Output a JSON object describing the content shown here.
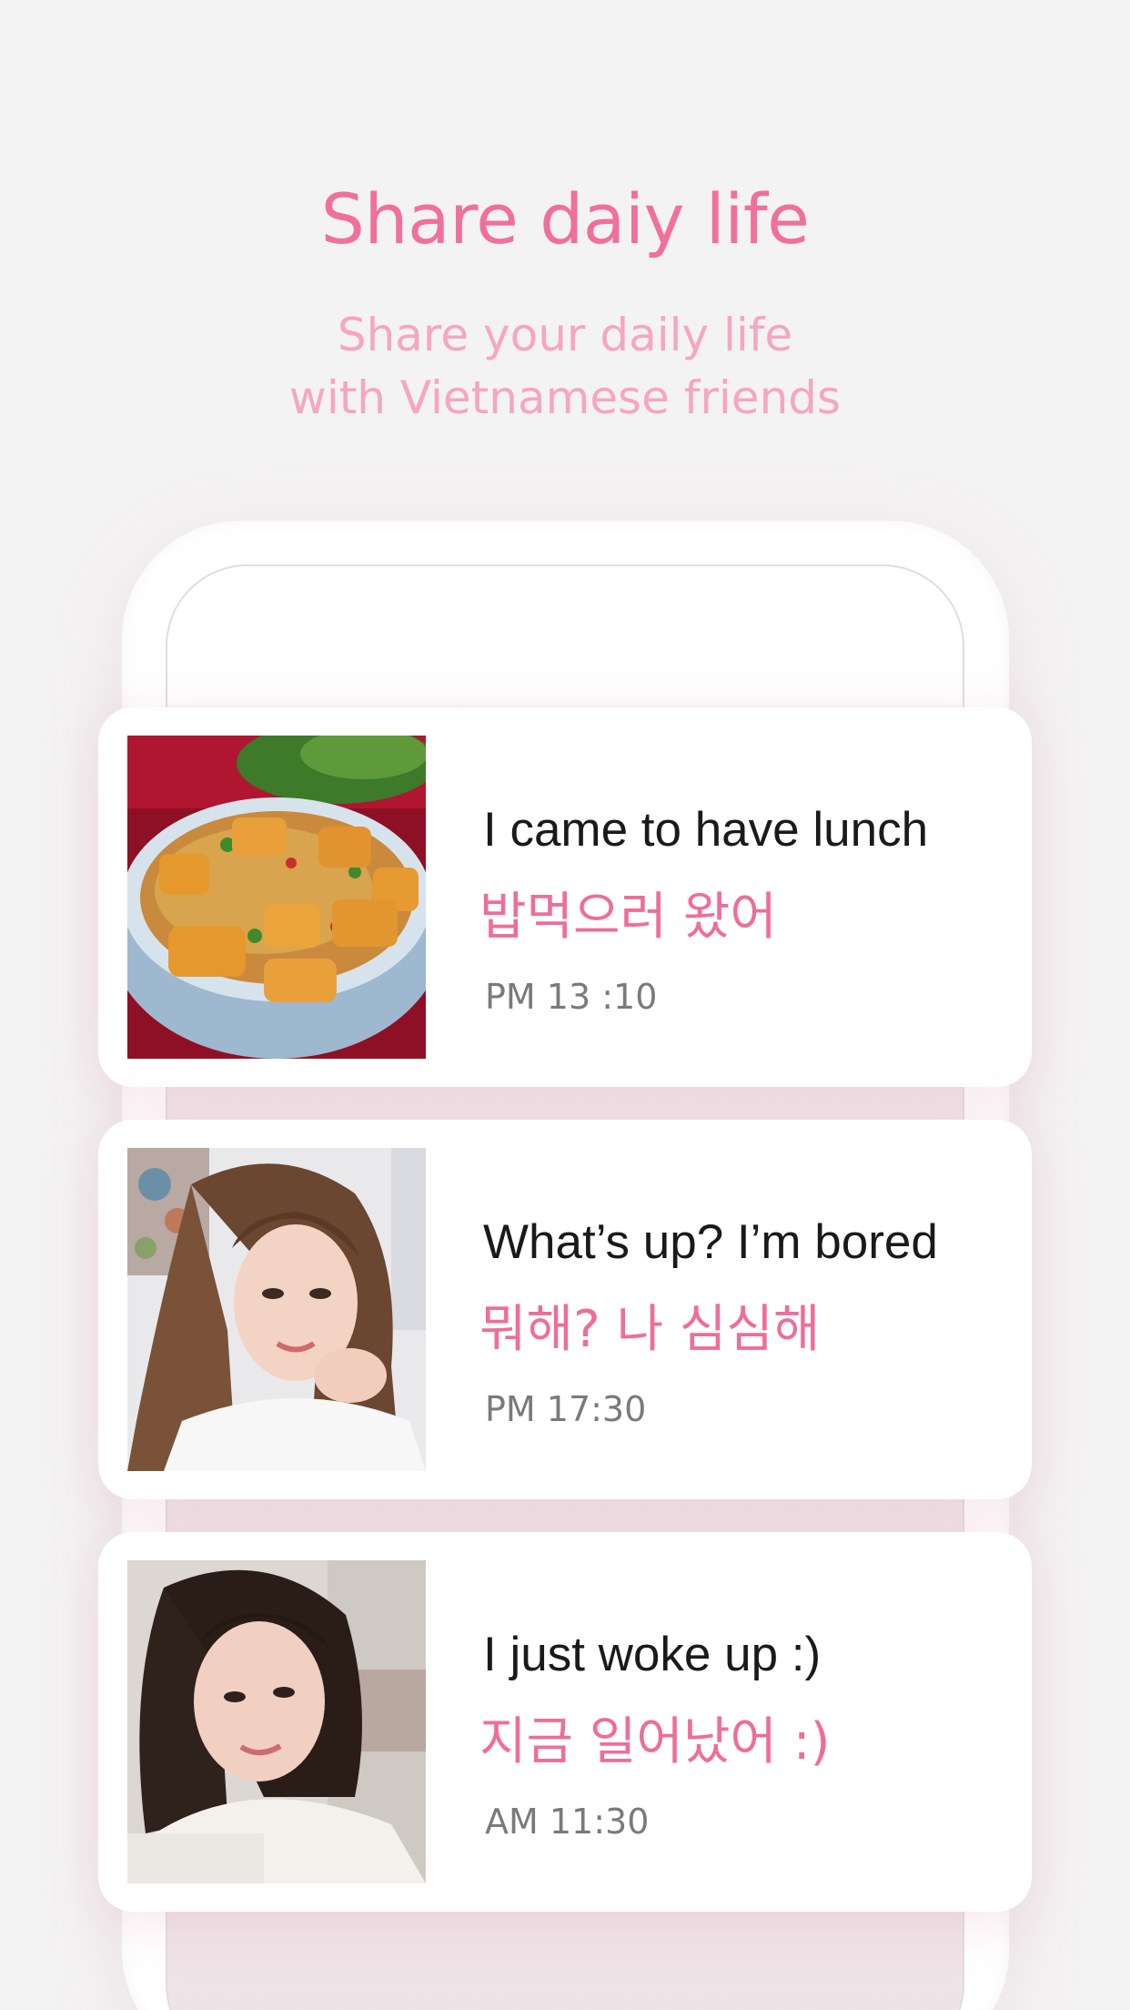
{
  "header": {
    "title": "Share daiy life",
    "subtitle_line1": "Share your daily life",
    "subtitle_line2": "with Vietnamese friends"
  },
  "colors": {
    "accent": "#f0709a",
    "accent_light": "#f6a6c0",
    "background": "#f4f3f3"
  },
  "messages": [
    {
      "text_en": "I came to have lunch",
      "text_ko": "밥먹으러 왔어",
      "time": "PM 13 :10",
      "photo": "noodle-soup-photo"
    },
    {
      "text_en": "What’s up? I’m bored",
      "text_ko": "뭐해? 나 심심해",
      "time": "PM 17:30",
      "photo": "woman-selfie-photo"
    },
    {
      "text_en": "I just woke up :)",
      "text_ko": "지금 일어났어 :)",
      "time": "AM 11:30",
      "photo": "woman-portrait-photo"
    }
  ]
}
